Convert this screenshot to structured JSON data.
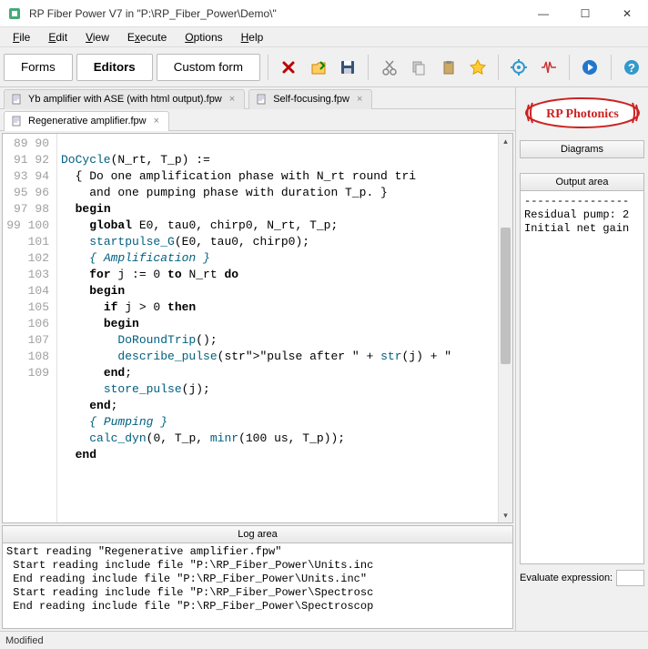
{
  "window": {
    "title": "RP Fiber Power V7 in \"P:\\RP_Fiber_Power\\Demo\\\"",
    "controls": {
      "minimize": "—",
      "maximize": "☐",
      "close": "✕"
    }
  },
  "menubar": {
    "items": [
      "File",
      "Edit",
      "View",
      "Execute",
      "Options",
      "Help"
    ]
  },
  "toolbar": {
    "buttons": {
      "forms": "Forms",
      "editors": "Editors",
      "custom_form": "Custom form"
    },
    "icons": {
      "delete": "delete-icon",
      "open": "open-icon",
      "save": "save-icon",
      "cut": "cut-icon",
      "copy": "copy-icon",
      "paste": "paste-icon",
      "favorite": "star-icon",
      "gear": "gear-icon",
      "pulse": "pulse-icon",
      "run": "play-icon",
      "help": "help-icon"
    }
  },
  "tabs": {
    "row1": [
      {
        "label": "Yb amplifier with ASE (with html output).fpw",
        "active": false
      },
      {
        "label": "Self-focusing.fpw",
        "active": false
      }
    ],
    "row2": [
      {
        "label": "Regenerative amplifier.fpw",
        "active": true
      }
    ]
  },
  "editor": {
    "first_line_number": 89,
    "lines": [
      "",
      "DoCycle(N_rt, T_p) :=",
      "  { Do one amplification phase with N_rt round tri",
      "    and one pumping phase with duration T_p. }",
      "  begin",
      "    global E0, tau0, chirp0, N_rt, T_p;",
      "    startpulse_G(E0, tau0, chirp0);",
      "    { Amplification }",
      "    for j := 0 to N_rt do",
      "    begin",
      "      if j > 0 then",
      "      begin",
      "        DoRoundTrip();",
      "        describe_pulse(\"pulse after \" + str(j) + \"",
      "      end;",
      "      store_pulse(j);",
      "    end;",
      "    { Pumping }",
      "    calc_dyn(0, T_p, minr(100 us, T_p));",
      "  end",
      ""
    ]
  },
  "log_area": {
    "header": "Log area",
    "lines": [
      "Start reading \"Regenerative amplifier.fpw\"",
      " Start reading include file \"P:\\RP_Fiber_Power\\Units.inc",
      " End reading include file \"P:\\RP_Fiber_Power\\Units.inc\"",
      " Start reading include file \"P:\\RP_Fiber_Power\\Spectrosc",
      " End reading include file \"P:\\RP_Fiber_Power\\Spectroscop"
    ]
  },
  "right": {
    "brand": "RP Photonics",
    "diagrams_header": "Diagrams",
    "output_area_header": "Output area",
    "output_lines": [
      "----------------",
      "Residual pump: 2",
      "Initial net gain"
    ],
    "eval_label": "Evaluate expression:",
    "eval_value": ""
  },
  "statusbar": {
    "status": "Modified"
  }
}
